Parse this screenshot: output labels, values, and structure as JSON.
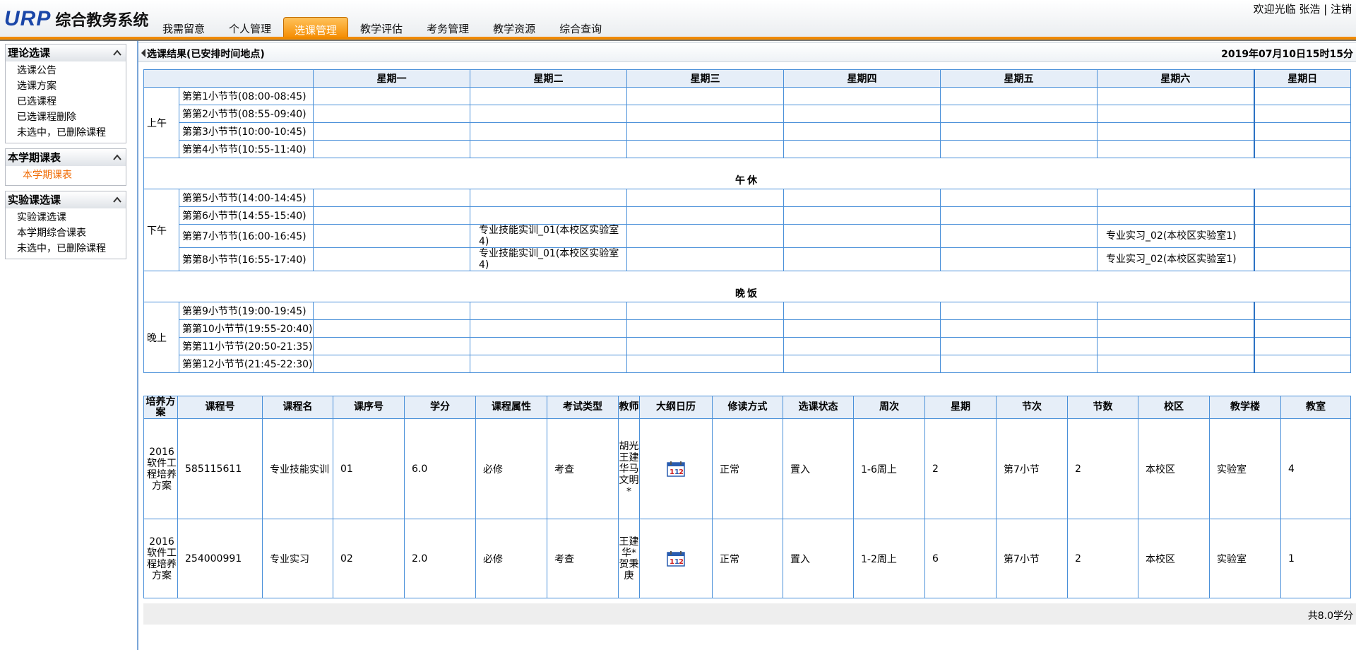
{
  "header": {
    "logo_text": "URP",
    "system_name": "综合教务系统",
    "welcome": "欢迎光临 张浩",
    "separator": "|",
    "logout": "注销"
  },
  "nav": {
    "tabs": [
      {
        "label": "我需留意"
      },
      {
        "label": "个人管理"
      },
      {
        "label": "选课管理",
        "active": true
      },
      {
        "label": "教学评估"
      },
      {
        "label": "考务管理"
      },
      {
        "label": "教学资源"
      },
      {
        "label": "综合查询"
      }
    ]
  },
  "sidebar": {
    "groups": [
      {
        "title": "理论选课",
        "items": [
          "选课公告",
          "选课方案",
          "已选课程",
          "已选课程删除",
          "未选中，已删除课程"
        ]
      },
      {
        "title": "本学期课表",
        "items": [
          "本学期课表"
        ],
        "current": "本学期课表"
      },
      {
        "title": "实验课选课",
        "items": [
          "实验课选课",
          "本学期综合课表",
          "未选中，已删除课程"
        ]
      }
    ]
  },
  "main": {
    "title": "选课结果(已安排时间地点)",
    "date": "2019年07月10日15时15分",
    "weekdays": [
      "星期一",
      "星期二",
      "星期三",
      "星期四",
      "星期五",
      "星期六",
      "星期日"
    ],
    "segments": {
      "morning": "上午",
      "afternoon": "下午",
      "evening": "晚上"
    },
    "breaks": {
      "noon": "午休",
      "dinner": "晚饭"
    },
    "periods": [
      "第第1小节节(08:00-08:45)",
      "第第2小节节(08:55-09:40)",
      "第第3小节节(10:00-10:45)",
      "第第4小节节(10:55-11:40)",
      "第第5小节节(14:00-14:45)",
      "第第6小节节(14:55-15:40)",
      "第第7小节节(16:00-16:45)",
      "第第8小节节(16:55-17:40)",
      "第第9小节节(19:00-19:45)",
      "第第10小节节(19:55-20:40)",
      "第第11小节节(20:50-21:35)",
      "第第12小节节(21:45-22:30)"
    ],
    "schedule": {
      "p7_tue": "专业技能实训_01(本校区实验室4)",
      "p7_sat": "专业实习_02(本校区实验室1)",
      "p8_tue": "专业技能实训_01(本校区实验室4)",
      "p8_sat": "专业实习_02(本校区实验室1)"
    }
  },
  "course_table": {
    "headers": [
      "培养方案",
      "课程号",
      "课程名",
      "课序号",
      "学分",
      "课程属性",
      "考试类型",
      "教师",
      "大纲日历",
      "修读方式",
      "选课状态",
      "周次",
      "星期",
      "节次",
      "节数",
      "校区",
      "教学楼",
      "教室"
    ],
    "rows": [
      {
        "plan": "2016软件工程培养方案",
        "course_no": "585115611",
        "course_name": "专业技能实训",
        "seq": "01",
        "credit": "6.0",
        "attr": "必修",
        "exam": "考查",
        "teacher": "胡光王建华马文明*",
        "mode": "正常",
        "status": "置入",
        "weeks": "1-6周上",
        "weekday": "2",
        "session": "第7小节",
        "count": "2",
        "campus": "本校区",
        "building": "实验室",
        "room": "4"
      },
      {
        "plan": "2016软件工程培养方案",
        "course_no": "254000991",
        "course_name": "专业实习",
        "seq": "02",
        "credit": "2.0",
        "attr": "必修",
        "exam": "考查",
        "teacher": "王建华*贺秉庚",
        "mode": "正常",
        "status": "置入",
        "weeks": "1-2周上",
        "weekday": "6",
        "session": "第7小节",
        "count": "2",
        "campus": "本校区",
        "building": "实验室",
        "room": "1"
      }
    ],
    "total": "共8.0学分"
  },
  "icons": {
    "collapse": "chevron-up-icon",
    "calendar": "calendar-icon",
    "title_arrow": "triangle-left-icon"
  },
  "colors": {
    "accent_orange": "#f08a00",
    "border_blue": "#4a90d9",
    "header_bg": "#e6eef8",
    "logo_blue": "#1a46a8",
    "current_item": "#f06a00"
  }
}
